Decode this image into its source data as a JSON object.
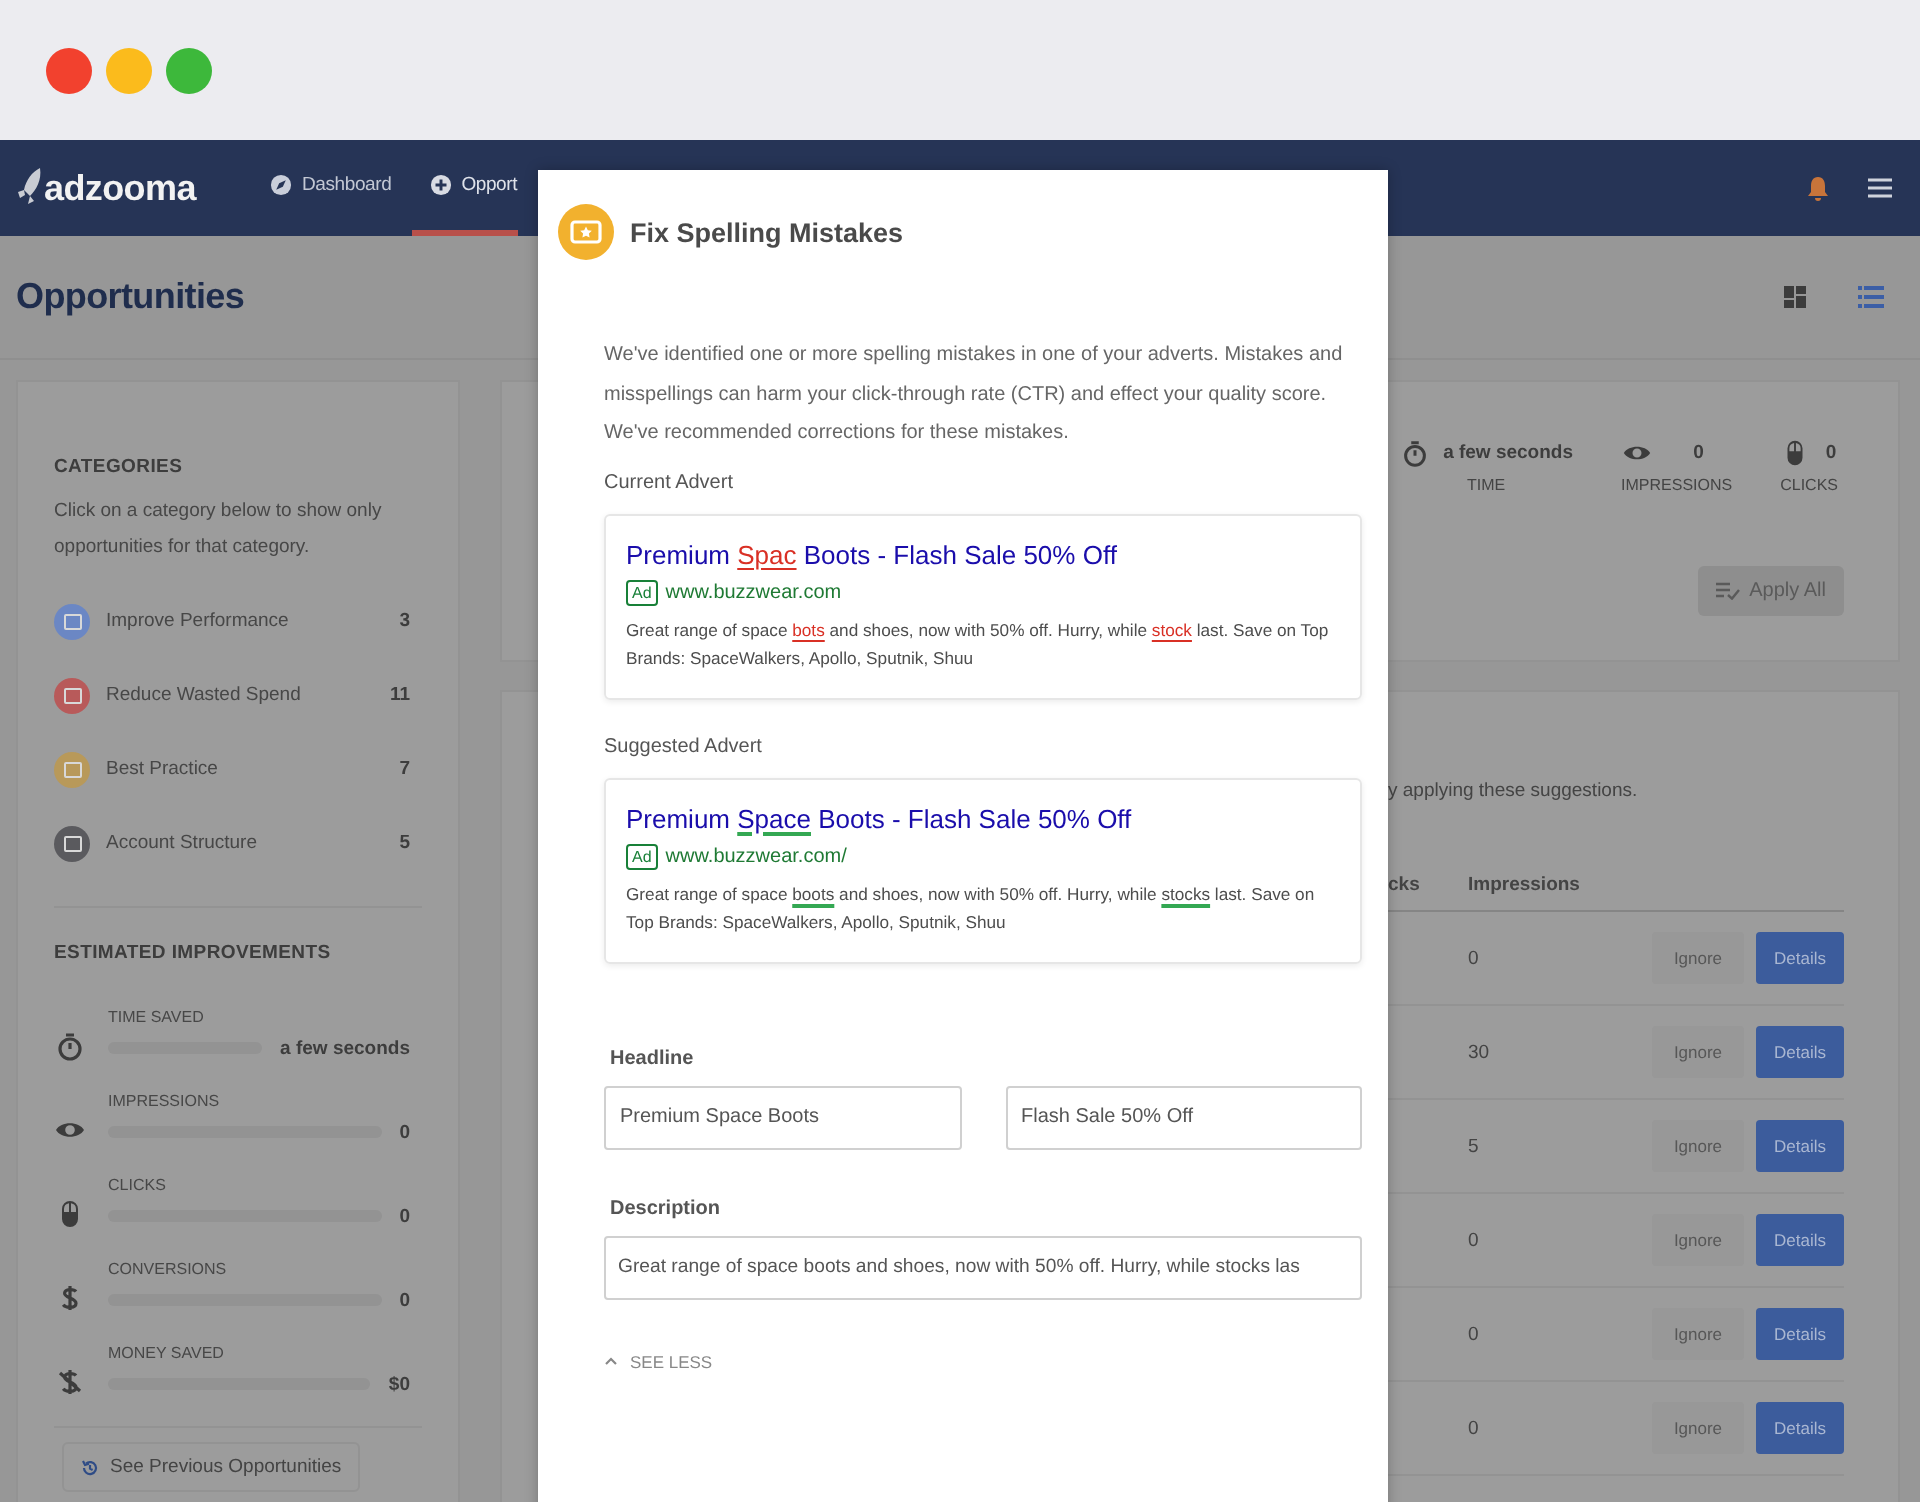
{
  "navbar": {
    "logo": "adzooma",
    "items": [
      {
        "label": "Dashboard",
        "kind": "dashboard",
        "selected": false
      },
      {
        "label": "Opport",
        "kind": "opportunities",
        "selected": true
      }
    ]
  },
  "page": {
    "title": "Opportunities",
    "views": [
      {
        "kind": "grid",
        "selected": false
      },
      {
        "kind": "list",
        "selected": true
      }
    ]
  },
  "sidebar": {
    "categories_heading": "CATEGORIES",
    "categories_hint": "Click on a category below to show only opportunities for that category.",
    "categories": [
      {
        "label": "Improve Performance",
        "count": "3",
        "color": "#6b87c4"
      },
      {
        "label": "Reduce Wasted Spend",
        "count": "11",
        "color": "#b85a5a"
      },
      {
        "label": "Best Practice",
        "count": "7",
        "color": "#b8995a"
      },
      {
        "label": "Account Structure",
        "count": "5",
        "color": "#5a5a5e"
      }
    ],
    "improvements_heading": "ESTIMATED IMPROVEMENTS",
    "improvements": [
      {
        "kind": "time",
        "label": "TIME SAVED",
        "level": 0,
        "value": "a few seconds"
      },
      {
        "kind": "impressions",
        "label": "IMPRESSIONS",
        "level": 0,
        "value": "0"
      },
      {
        "kind": "clicks",
        "label": "CLICKS",
        "level": 0,
        "value": "0"
      },
      {
        "kind": "conversions",
        "label": "CONVERSIONS",
        "level": 0,
        "value": "0"
      },
      {
        "kind": "money",
        "label": "MONEY SAVED",
        "level": 0,
        "value": "$0"
      }
    ],
    "history_button": "See Previous Opportunities"
  },
  "summary": {
    "stats": [
      {
        "kind": "time",
        "value": "a few seconds",
        "label": "TIME"
      },
      {
        "kind": "impressions",
        "value": "0",
        "label": "IMPRESSIONS"
      },
      {
        "kind": "clicks",
        "value": "0",
        "label": "CLICKS"
      }
    ],
    "apply_button": "Apply All"
  },
  "suggestions": {
    "intro": "y applying these suggestions.",
    "columns": [
      "cks",
      "Impressions"
    ],
    "rows": [
      {
        "impressions": "0",
        "ignore": "Ignore",
        "details": "Details"
      },
      {
        "impressions": "30",
        "ignore": "Ignore",
        "details": "Details"
      },
      {
        "impressions": "5",
        "ignore": "Ignore",
        "details": "Details"
      },
      {
        "impressions": "0",
        "ignore": "Ignore",
        "details": "Details"
      },
      {
        "impressions": "0",
        "ignore": "Ignore",
        "details": "Details"
      },
      {
        "impressions": "0",
        "ignore": "Ignore",
        "details": "Details"
      }
    ]
  },
  "modal": {
    "title": "Fix Spelling Mistakes",
    "intro": "We've identified one or more spelling mistakes in one of your adverts. Mistakes and misspellings can harm your click-through rate (CTR) and effect your quality score. We've recommended corrections for these mistakes.",
    "adverts": [
      {
        "heading": "Current Advert",
        "badge": "Ad",
        "url": "www.buzzwear.com",
        "headline": [
          {
            "text": "Premium ",
            "kind": "plain"
          },
          {
            "text": "Spac",
            "kind": "error"
          },
          {
            "text": " Boots - Flash Sale 50% Off",
            "kind": "plain"
          }
        ],
        "description": [
          {
            "text": "Great range of space ",
            "kind": "plain"
          },
          {
            "text": "bots",
            "kind": "error"
          },
          {
            "text": " and shoes, now with 50% off. Hurry, while ",
            "kind": "plain"
          },
          {
            "text": "stock",
            "kind": "error"
          },
          {
            "text": " last. Save on Top Brands: SpaceWalkers, Apollo, Sputnik, Shuu",
            "kind": "plain"
          }
        ]
      },
      {
        "heading": "Suggested Advert",
        "badge": "Ad",
        "url": "www.buzzwear.com/",
        "headline": [
          {
            "text": "Premium ",
            "kind": "plain"
          },
          {
            "text": "Space",
            "kind": "fix"
          },
          {
            "text": " Boots - Flash Sale 50% Off",
            "kind": "plain"
          }
        ],
        "description": [
          {
            "text": "Great range of space ",
            "kind": "plain"
          },
          {
            "text": "boots",
            "kind": "fix"
          },
          {
            "text": " and shoes, now with 50% off. Hurry, while ",
            "kind": "plain"
          },
          {
            "text": "stocks",
            "kind": "fix"
          },
          {
            "text": " last. Save on Top Brands: SpaceWalkers, Apollo, Sputnik, Shuu",
            "kind": "plain"
          }
        ]
      }
    ],
    "headline_label": "Headline",
    "headline_fields": [
      "Premium Space Boots",
      "Flash Sale 50% Off"
    ],
    "description_label": "Description",
    "description_field": "Great range of space boots and shoes, now with 50% off. Hurry, while stocks las",
    "toggle": "SEE LESS"
  }
}
